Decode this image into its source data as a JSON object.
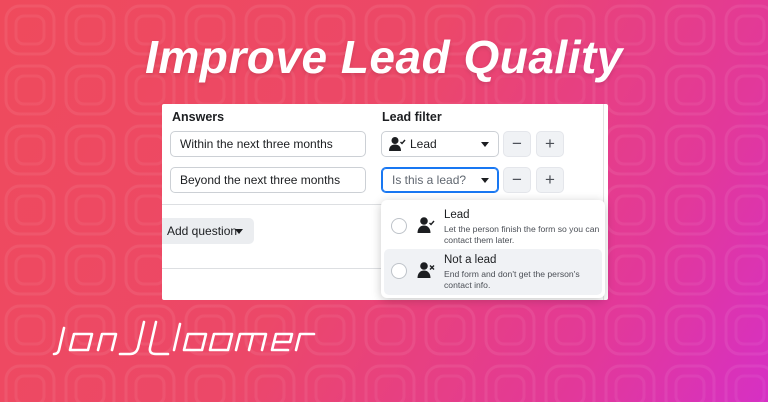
{
  "headline": "Improve Lead Quality",
  "form": {
    "answers_header": "Answers",
    "filter_header": "Lead filter",
    "rows": [
      {
        "answer": "Within the next three months",
        "filter_value": "Lead",
        "filter_icon": "person-check-icon"
      },
      {
        "answer": "Beyond the next three months",
        "filter_placeholder": "Is this a lead?"
      }
    ],
    "remove_symbol": "−",
    "add_symbol": "+",
    "add_question_label": "Add question"
  },
  "dropdown": {
    "options": [
      {
        "title": "Lead",
        "description": "Let the person finish the form so you can contact them later.",
        "icon": "person-check-icon"
      },
      {
        "title": "Not a lead",
        "description": "End form and don't get the person's contact info.",
        "icon": "person-x-icon"
      }
    ]
  },
  "brand": {
    "logo_text": "jon loomer"
  },
  "colors": {
    "focus_blue": "#1877f2",
    "bg_start": "#ef4a5c",
    "bg_end": "#d630c4"
  }
}
